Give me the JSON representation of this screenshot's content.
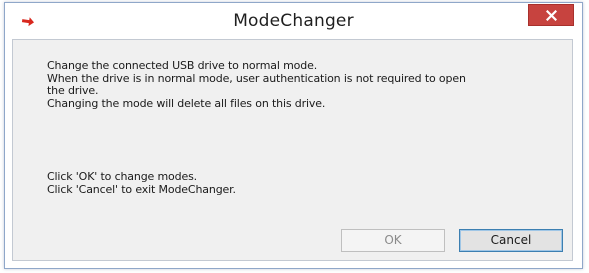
{
  "window": {
    "title": "ModeChanger",
    "app_icon": "red-arrow-icon",
    "close_icon": "close-icon",
    "close_button_color": "#c7433f"
  },
  "message": {
    "lines": [
      "Change the connected USB drive to normal mode.",
      "When the drive is in normal mode, user authentication is not required to open",
      "the drive.",
      "Changing the mode will delete all files on this drive."
    ]
  },
  "instructions": {
    "lines": [
      "Click 'OK' to change modes.",
      "Click 'Cancel' to exit ModeChanger."
    ]
  },
  "buttons": {
    "ok_label": "OK",
    "cancel_label": "Cancel"
  }
}
